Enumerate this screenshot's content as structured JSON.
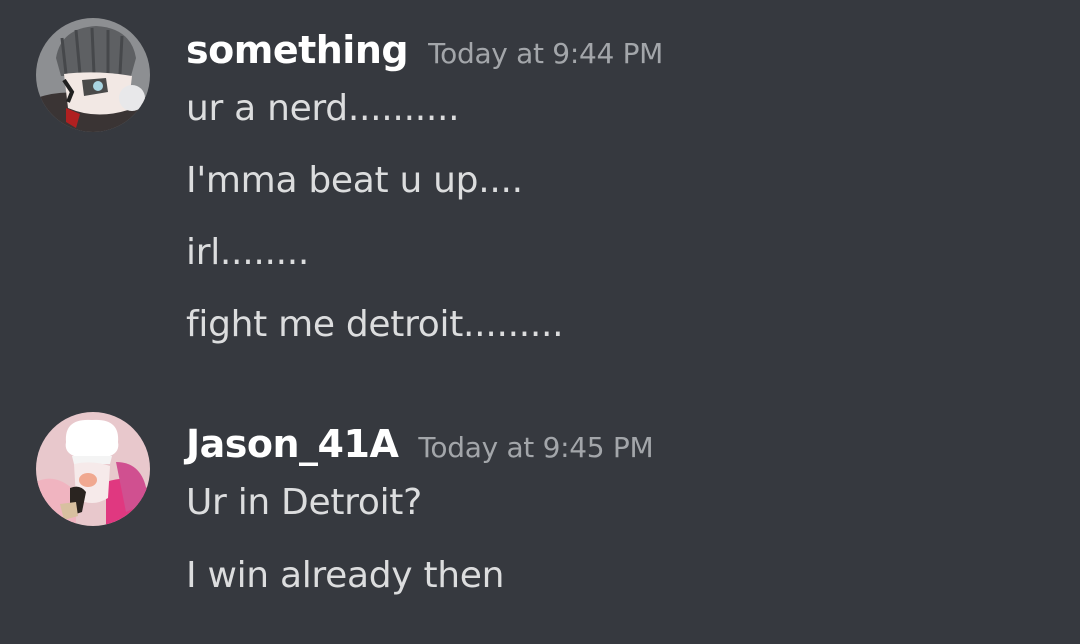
{
  "colors": {
    "background": "#36393f",
    "username": "#ffffff",
    "timestamp": "#a3a6aa",
    "message_text": "#dcddde"
  },
  "messages": [
    {
      "avatar_icon": "gray-beanie-character-avatar-icon",
      "username": "something",
      "timestamp": "Today at 9:44 PM",
      "lines": [
        "ur a nerd..........",
        "I'mma beat u up....",
        "irl........",
        "fight me detroit........."
      ]
    },
    {
      "avatar_icon": "chef-hat-character-avatar-icon",
      "username": "Jason_41A",
      "timestamp": "Today at 9:45 PM",
      "lines": [
        "Ur in Detroit?",
        "I win already then"
      ]
    }
  ]
}
